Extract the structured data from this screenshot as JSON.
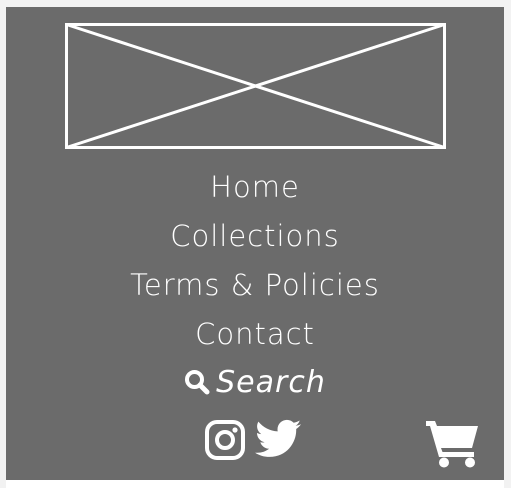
{
  "logo": {
    "icon": "image-placeholder-icon"
  },
  "nav": {
    "items": [
      {
        "label": "Home"
      },
      {
        "label": "Collections"
      },
      {
        "label": "Terms & Policies"
      },
      {
        "label": "Contact"
      }
    ]
  },
  "search": {
    "label": "Search",
    "icon": "search-icon"
  },
  "social": {
    "instagram": {
      "icon": "instagram-icon"
    },
    "twitter": {
      "icon": "twitter-icon"
    }
  },
  "cart": {
    "icon": "shopping-cart-icon"
  },
  "colors": {
    "panel_bg": "#6b6b6b",
    "text": "#ffffff",
    "page_bg": "#f2f2f2"
  }
}
